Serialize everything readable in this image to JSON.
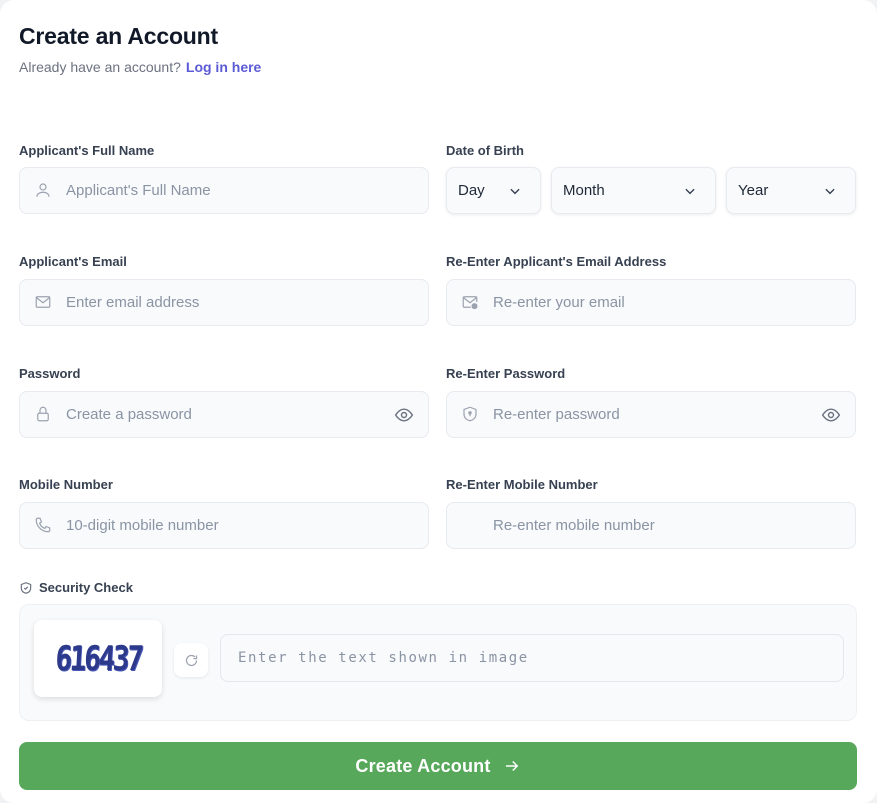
{
  "header": {
    "title": "Create an Account",
    "subtitle": "Already have an account?",
    "login_link": "Log in here"
  },
  "fields": {
    "full_name": {
      "label": "Applicant's Full Name",
      "placeholder": "Applicant's Full Name",
      "icon": "user-icon"
    },
    "dob": {
      "label": "Date of Birth",
      "day": "Day",
      "month": "Month",
      "year": "Year"
    },
    "email": {
      "label": "Applicant's Email",
      "placeholder": "Enter email address",
      "icon": "mail-icon"
    },
    "email_confirm": {
      "label": "Re-Enter Applicant's Email Address",
      "placeholder": "Re-enter your email",
      "icon": "mail-check-icon"
    },
    "password": {
      "label": "Password",
      "placeholder": "Create a password",
      "icon": "lock-icon"
    },
    "password_confirm": {
      "label": "Re-Enter Password",
      "placeholder": "Re-enter password",
      "icon": "shield-icon"
    },
    "mobile": {
      "label": "Mobile Number",
      "placeholder": "10-digit mobile number",
      "icon": "phone-icon"
    },
    "mobile_confirm": {
      "label": "Re-Enter Mobile Number",
      "placeholder": "Re-enter mobile number"
    }
  },
  "security": {
    "label": "Security Check",
    "captcha_text": "616437",
    "input_placeholder": "Enter the text shown in image"
  },
  "submit": {
    "label": "Create Account"
  },
  "colors": {
    "primary_button": "#57a85a",
    "link": "#5b5bd6"
  }
}
